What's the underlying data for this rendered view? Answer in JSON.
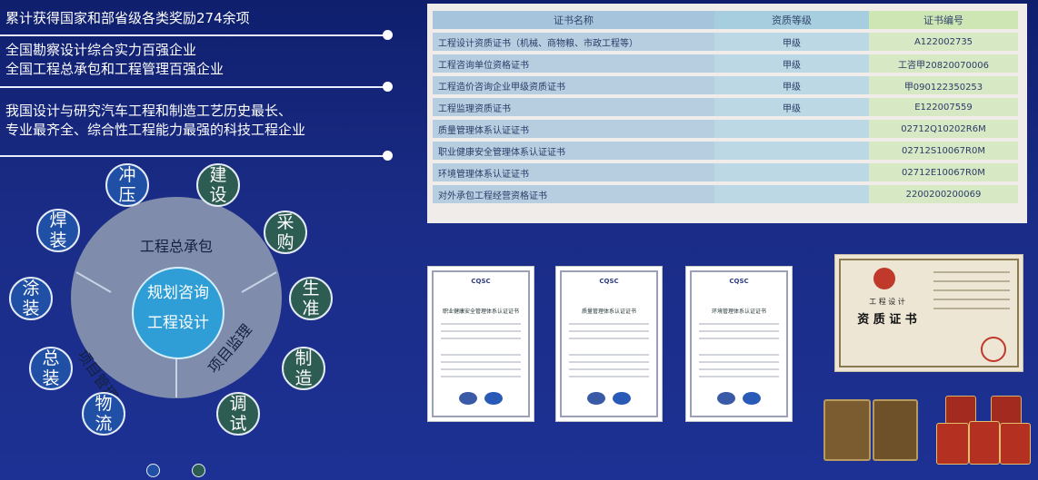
{
  "statements": {
    "s1": "累计获得国家和部省级各类奖励274余项",
    "s2a": "全国勘察设计综合实力百强企业",
    "s2b": "全国工程总承包和工程管理百强企业",
    "s3a": "我国设计与研究汽车工程和制造工艺历史最长、",
    "s3b": "专业最齐全、综合性工程能力最强的科技工程企业"
  },
  "diagram": {
    "core_line1": "规划咨询",
    "core_line2": "工程设计",
    "ring_top": "工程总承包",
    "ring_left": "项目管理",
    "ring_right": "项目监理",
    "satellites": [
      {
        "label": "冲压",
        "color": "blue"
      },
      {
        "label": "建设",
        "color": "green"
      },
      {
        "label": "焊装",
        "color": "blue"
      },
      {
        "label": "采购",
        "color": "green"
      },
      {
        "label": "涂装",
        "color": "blue"
      },
      {
        "label": "生准",
        "color": "green"
      },
      {
        "label": "总装",
        "color": "blue"
      },
      {
        "label": "制造",
        "color": "green"
      },
      {
        "label": "物流",
        "color": "blue"
      },
      {
        "label": "调试",
        "color": "green"
      }
    ]
  },
  "cert_table": {
    "headers": [
      "证书名称",
      "资质等级",
      "证书编号"
    ],
    "rows": [
      [
        "工程设计资质证书（机械、商物粮、市政工程等）",
        "甲级",
        "A122002735"
      ],
      [
        "工程咨询单位资格证书",
        "甲级",
        "工咨甲20820070006"
      ],
      [
        "工程造价咨询企业甲级资质证书",
        "甲级",
        "甲090122350253"
      ],
      [
        "工程监理资质证书",
        "甲级",
        "E122007559"
      ],
      [
        "质量管理体系认证证书",
        "",
        "02712Q10202R6M"
      ],
      [
        "职业健康安全管理体系认证证书",
        "",
        "02712S10067R0M"
      ],
      [
        "环境管理体系认证证书",
        "",
        "02712E10067R0M"
      ],
      [
        "对外承包工程经营资格证书",
        "",
        "2200200200069"
      ]
    ]
  },
  "certificates": {
    "cert1_title": "职业健康安全管理体系认证证书",
    "cert2_title": "质量管理体系认证证书",
    "cert3_title": "环境管理体系认证证书",
    "logo_text": "CQSC",
    "zizhi_line1": "工 程 设 计",
    "zizhi_line2": "资 质 证 书"
  },
  "colors": {
    "background": "#1a2c86",
    "core": "#2f9ed6",
    "sat_blue": "#2050a6",
    "sat_green": "#2c5c52"
  }
}
